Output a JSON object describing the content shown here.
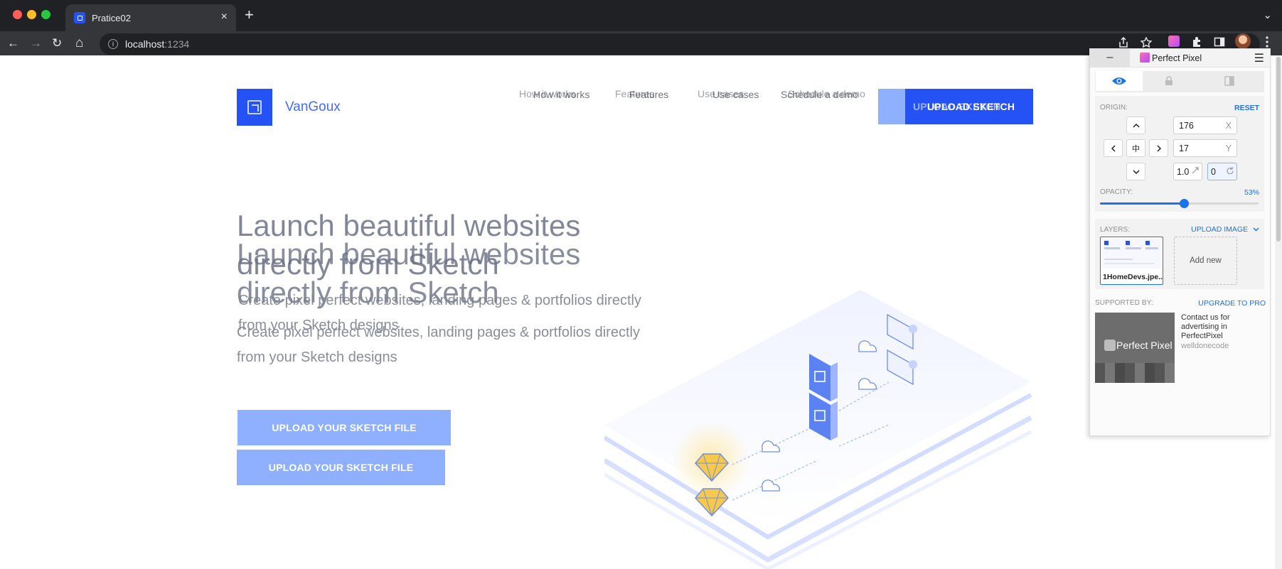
{
  "browser": {
    "tab_title": "Pratice02",
    "tab_close": "×",
    "new_tab": "+",
    "tab_menu": "⌄",
    "url_host": "localhost",
    "url_port": ":1234",
    "back": "←",
    "forward": "→",
    "reload": "↻",
    "home": "⌂"
  },
  "site": {
    "brand": "VanGoux",
    "nav": [
      "How it works",
      "Features",
      "Use cases",
      "Schedule a demo"
    ],
    "cta": "UPLOAD SKETCH",
    "hero_title_line1": "Launch beautiful websites",
    "hero_title_line2": "directly from Sketch",
    "hero_subtitle_line1": "Create pixel perfect websites, landing pages & portfolios directly",
    "hero_subtitle_line2": "from your Sketch designs",
    "upload_button": "UPLOAD YOUR SKETCH FILE"
  },
  "perfect_pixel": {
    "minimize": "–",
    "title": "Perfect Pixel",
    "menu": "☰",
    "origin_label": "ORIGIN:",
    "reset": "RESET",
    "x_value": "176",
    "x_unit": "X",
    "y_value": "17",
    "y_unit": "Y",
    "scale_value": "1.0",
    "rotation_value": "0",
    "opacity_label": "OPACITY:",
    "opacity_text": "53%",
    "opacity_fraction": 0.53,
    "layers_label": "LAYERS:",
    "upload_image": "UPLOAD IMAGE",
    "layer_name": "1HomeDevs.jpe...",
    "add_new": "Add new",
    "supported_by": "SUPPORTED BY:",
    "upgrade": "UPGRADE TO PRO",
    "ad_image_text": "Perfect Pixel",
    "ad_text": "Contact us for advertising in PerfectPixel",
    "ad_sub": "welldonecode",
    "center_glyph": "中"
  },
  "colors": {
    "accent": "#2552f5",
    "accent_light": "#8fb0ff",
    "extension_blue": "#1a73e8",
    "illustration_gold": "#f7c94b"
  }
}
